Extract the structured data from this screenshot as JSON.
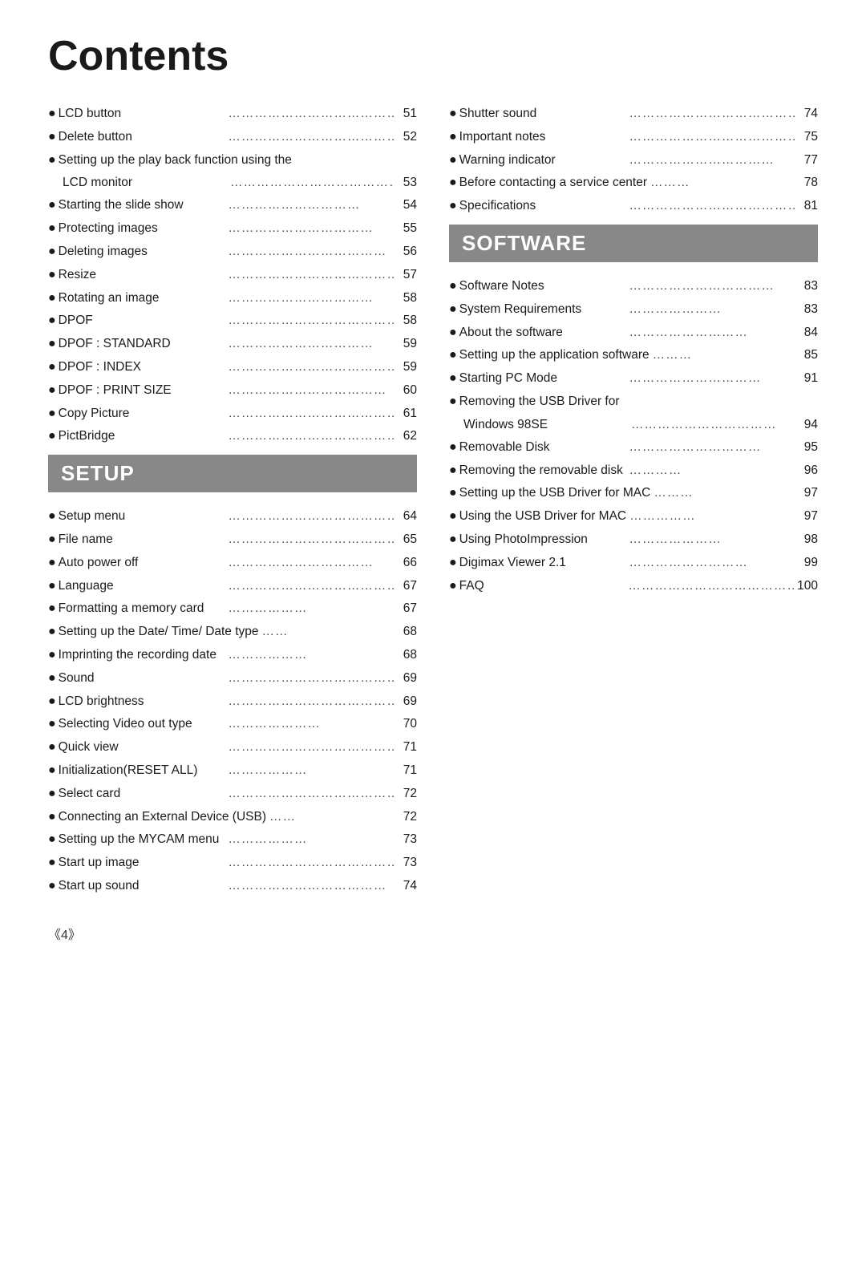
{
  "title": "Contents",
  "footer": "《4》",
  "leftColumn": {
    "topItems": [
      {
        "bullet": "●",
        "label": "LCD button",
        "dots": "……………………………………",
        "page": "51"
      },
      {
        "bullet": "●",
        "label": "Delete button",
        "dots": "……………………………………",
        "page": "52"
      },
      {
        "bullet": "●",
        "label": "Setting up the play back function using the",
        "dots": "",
        "page": ""
      },
      {
        "bullet": "",
        "label": "LCD monitor",
        "dots": "……………………………………",
        "page": "53",
        "indent": true
      },
      {
        "bullet": "●",
        "label": "Starting the slide show",
        "dots": "…………………………",
        "page": "54"
      },
      {
        "bullet": "●",
        "label": "Protecting images",
        "dots": "……………………………",
        "page": "55"
      },
      {
        "bullet": "●",
        "label": "Deleting images",
        "dots": "………………………………",
        "page": "56"
      },
      {
        "bullet": "●",
        "label": "Resize",
        "dots": "……………………………………………",
        "page": "57"
      },
      {
        "bullet": "●",
        "label": "Rotating an image",
        "dots": "……………………………",
        "page": "58"
      },
      {
        "bullet": "●",
        "label": "DPOF",
        "dots": "……………………………………………",
        "page": "58"
      },
      {
        "bullet": "●",
        "label": "DPOF : STANDARD",
        "dots": "……………………………",
        "page": "59"
      },
      {
        "bullet": "●",
        "label": "DPOF : INDEX",
        "dots": "…………………………………",
        "page": "59"
      },
      {
        "bullet": "●",
        "label": "DPOF : PRINT SIZE",
        "dots": "………………………………",
        "page": "60"
      },
      {
        "bullet": "●",
        "label": "Copy Picture",
        "dots": "…………………………………",
        "page": "61"
      },
      {
        "bullet": "●",
        "label": "PictBridge",
        "dots": "……………………………………",
        "page": "62"
      }
    ],
    "setupSection": {
      "header": "SETUP",
      "items": [
        {
          "bullet": "●",
          "label": "Setup menu",
          "dots": "…………………………………",
          "page": "64"
        },
        {
          "bullet": "●",
          "label": "File name",
          "dots": "……………………………………",
          "page": "65"
        },
        {
          "bullet": "●",
          "label": "Auto power off",
          "dots": "……………………………",
          "page": "66"
        },
        {
          "bullet": "●",
          "label": "Language",
          "dots": "………………………………………",
          "page": "67"
        },
        {
          "bullet": "●",
          "label": "Formatting a memory card",
          "dots": "………………",
          "page": "67"
        },
        {
          "bullet": "●",
          "label": "Setting up the Date/ Time/ Date type",
          "dots": "……",
          "page": "68"
        },
        {
          "bullet": "●",
          "label": "Imprinting the recording date",
          "dots": "………………",
          "page": "68"
        },
        {
          "bullet": "●",
          "label": "Sound",
          "dots": "…………………………………………",
          "page": "69"
        },
        {
          "bullet": "●",
          "label": "LCD brightness",
          "dots": "…………………………………",
          "page": "69"
        },
        {
          "bullet": "●",
          "label": "Selecting Video out type",
          "dots": "…………………",
          "page": "70"
        },
        {
          "bullet": "●",
          "label": "Quick view",
          "dots": "……………………………………",
          "page": "71"
        },
        {
          "bullet": "●",
          "label": "Initialization(RESET ALL)",
          "dots": "………………",
          "page": "71"
        },
        {
          "bullet": "●",
          "label": "Select card",
          "dots": "………………………………………",
          "page": "72"
        },
        {
          "bullet": "●",
          "label": "Connecting an External Device (USB)",
          "dots": "……",
          "page": "72"
        },
        {
          "bullet": "●",
          "label": "Setting up the MYCAM menu",
          "dots": "………………",
          "page": "73"
        },
        {
          "bullet": "●",
          "label": "Start up image",
          "dots": "…………………………………",
          "page": "73"
        },
        {
          "bullet": "●",
          "label": "Start up sound",
          "dots": "………………………………",
          "page": "74"
        }
      ]
    }
  },
  "rightColumn": {
    "topItems": [
      {
        "bullet": "●",
        "label": "Shutter sound",
        "dots": "……………………………………",
        "page": "74"
      },
      {
        "bullet": "●",
        "label": "Important notes",
        "dots": "…………………………………",
        "page": "75"
      },
      {
        "bullet": "●",
        "label": "Warning indicator",
        "dots": "……………………………",
        "page": "77"
      },
      {
        "bullet": "●",
        "label": "Before contacting a service center",
        "dots": "………",
        "page": "78"
      },
      {
        "bullet": "●",
        "label": "Specifications",
        "dots": "…………………………………",
        "page": "81"
      }
    ],
    "softwareSection": {
      "header": "SOFTWARE",
      "items": [
        {
          "bullet": "●",
          "label": "Software Notes",
          "dots": "……………………………",
          "page": "83"
        },
        {
          "bullet": "●",
          "label": "System Requirements",
          "dots": "…………………",
          "page": "83"
        },
        {
          "bullet": "●",
          "label": "About the software",
          "dots": "………………………",
          "page": "84"
        },
        {
          "bullet": "●",
          "label": "Setting up the application software",
          "dots": "………",
          "page": "85"
        },
        {
          "bullet": "●",
          "label": "Starting PC Mode",
          "dots": "…………………………",
          "page": "91"
        },
        {
          "bullet": "●",
          "label": "Removing the USB Driver for",
          "dots": "",
          "page": ""
        },
        {
          "bullet": "",
          "label": "Windows 98SE",
          "dots": "……………………………",
          "page": "94",
          "indent": true
        },
        {
          "bullet": "●",
          "label": "Removable Disk",
          "dots": "…………………………",
          "page": "95"
        },
        {
          "bullet": "●",
          "label": "Removing the removable disk",
          "dots": "…………",
          "page": "96"
        },
        {
          "bullet": "●",
          "label": "Setting up the USB Driver for MAC",
          "dots": "………",
          "page": "97"
        },
        {
          "bullet": "●",
          "label": "Using the USB Driver for MAC",
          "dots": "……………",
          "page": "97"
        },
        {
          "bullet": "●",
          "label": "Using PhotoImpression",
          "dots": "…………………",
          "page": "98"
        },
        {
          "bullet": "●",
          "label": "Digimax Viewer 2.1",
          "dots": "………………………",
          "page": "99"
        },
        {
          "bullet": "●",
          "label": "FAQ",
          "dots": "………………………………………………",
          "page": "100"
        }
      ]
    }
  }
}
